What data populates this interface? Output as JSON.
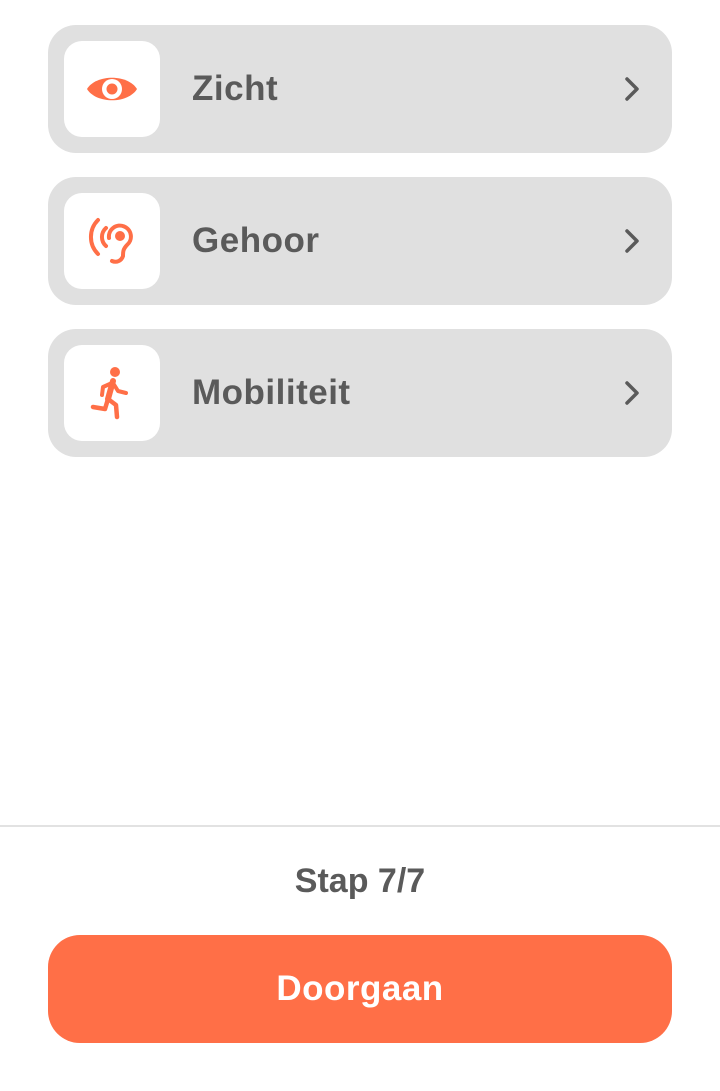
{
  "colors": {
    "accent": "#ff6f47",
    "card_background": "#e0e0e0",
    "text": "#5a5a5a"
  },
  "options": [
    {
      "label": "Zicht",
      "icon": "eye-icon"
    },
    {
      "label": "Gehoor",
      "icon": "hearing-icon"
    },
    {
      "label": "Mobiliteit",
      "icon": "running-person-icon"
    }
  ],
  "footer": {
    "step_label": "Stap 7/7",
    "continue_label": "Doorgaan"
  }
}
